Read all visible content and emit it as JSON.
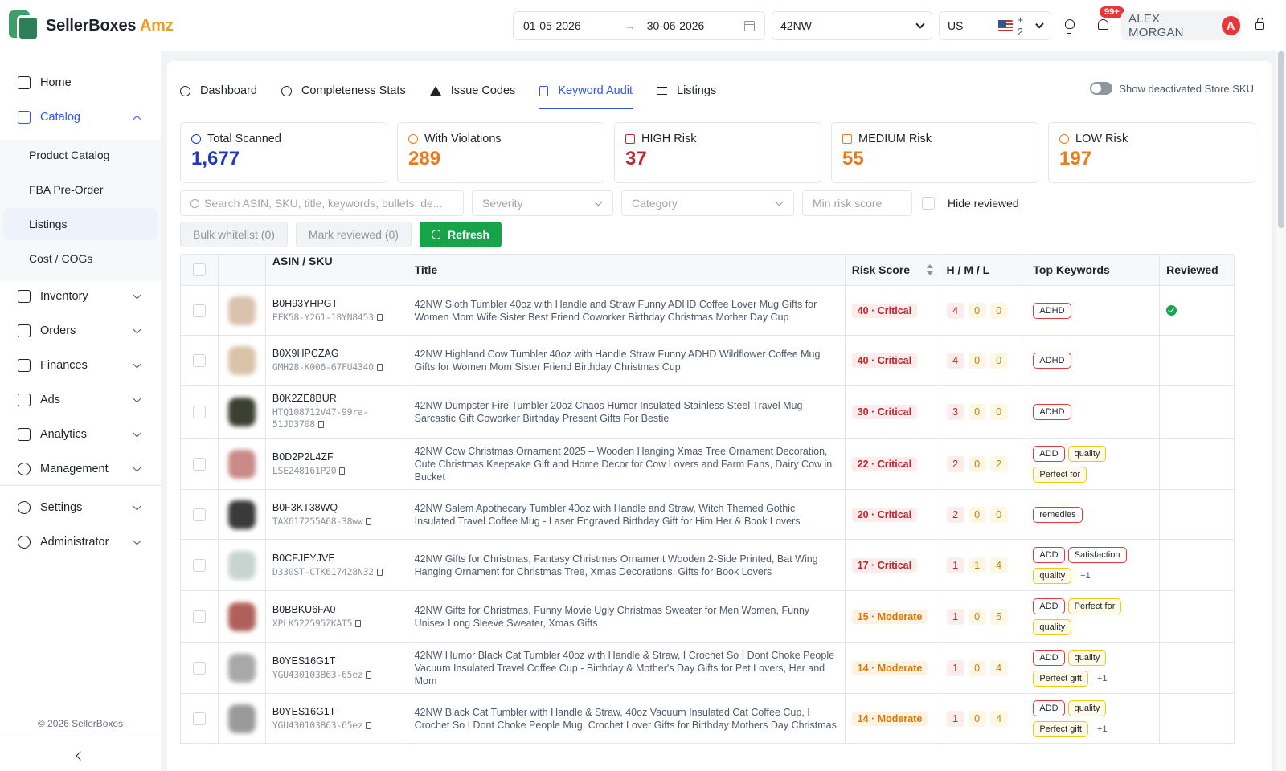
{
  "app": {
    "name": "SellerBoxes",
    "name_suffix": "Amz"
  },
  "topbar": {
    "date_from": "01-05-2026",
    "date_arrow": "→",
    "date_to": "30-06-2026",
    "store": "42NW",
    "marketplace": "US",
    "marketplace_extra": "+ 2",
    "notifications_badge": "99+",
    "user_name": "ALEX MORGAN",
    "user_initial": "A"
  },
  "sidebar": {
    "items": [
      {
        "label": "Home"
      },
      {
        "label": "Catalog"
      },
      {
        "label": "Inventory"
      },
      {
        "label": "Orders"
      },
      {
        "label": "Finances"
      },
      {
        "label": "Ads"
      },
      {
        "label": "Analytics"
      },
      {
        "label": "Management"
      },
      {
        "label": "Settings"
      },
      {
        "label": "Administrator"
      }
    ],
    "catalog_sub": [
      {
        "label": "Product Catalog"
      },
      {
        "label": "FBA Pre-Order"
      },
      {
        "label": "Listings"
      },
      {
        "label": "Cost / COGs"
      }
    ],
    "copyright": "© 2026 SellerBoxes"
  },
  "tabs": [
    {
      "label": "Dashboard"
    },
    {
      "label": "Completeness Stats"
    },
    {
      "label": "Issue Codes"
    },
    {
      "label": "Keyword Audit"
    },
    {
      "label": "Listings"
    }
  ],
  "toggle_label": "Show deactivated Store SKU",
  "stats": [
    {
      "label": "Total Scanned",
      "value": "1,677",
      "color": "#1d39c4"
    },
    {
      "label": "With Violations",
      "value": "289",
      "color": "#ea7a1a"
    },
    {
      "label": "HIGH Risk",
      "value": "37",
      "color": "#c0262d"
    },
    {
      "label": "MEDIUM Risk",
      "value": "55",
      "color": "#ea7a1a"
    },
    {
      "label": "LOW Risk",
      "value": "197",
      "color": "#ea7a1a"
    }
  ],
  "filters": {
    "search_placeholder": "Search ASIN, SKU, title, keywords, bullets, de...",
    "severity_placeholder": "Severity",
    "category_placeholder": "Category",
    "min_risk_placeholder": "Min risk score",
    "hide_reviewed": "Hide reviewed"
  },
  "actions": {
    "bulk_whitelist": "Bulk whitelist (0)",
    "mark_reviewed": "Mark reviewed (0)",
    "refresh": "Refresh"
  },
  "table": {
    "headers": [
      "ASIN / SKU",
      "Title",
      "Risk Score",
      "H / M / L",
      "Top Keywords",
      "Reviewed"
    ],
    "rows": [
      {
        "asin": "B0H93YHPGT",
        "sku": "EFK58-Y261-18YN8453",
        "title": "42NW Sloth Tumbler 40oz with Handle and Straw Funny ADHD Coffee Lover Mug Gifts for Women Mom Wife Sister Best Friend Coworker Birthday Christmas Mother Day Cup",
        "risk": "40 · Critical",
        "h": "4",
        "m": "0",
        "l": "0",
        "reviewed": true,
        "thumb": "#d8c2ae"
      },
      {
        "asin": "B0X9HPCZAG",
        "sku": "GMH28-K006-67FU4340",
        "title": "42NW Highland Cow Tumbler 40oz with Handle Straw Funny ADHD Wildflower Coffee Mug Gifts for Women Mom Sister Friend Birthday Christmas Cup",
        "risk": "40 · Critical",
        "h": "4",
        "m": "0",
        "l": "0",
        "reviewed": false,
        "thumb": "#d9c3a8"
      },
      {
        "asin": "B0K2ZE8BUR",
        "sku": "HTQ108712V47-99ra-51JD3708",
        "title": "42NW Dumpster Fire Tumbler 20oz Chaos Humor Insulated Stainless Steel Travel Mug Sarcastic Gift Coworker Birthday Present Gifts For Bestie",
        "risk": "30 · Critical",
        "h": "3",
        "m": "0",
        "l": "0",
        "reviewed": false,
        "thumb": "#3c4030"
      },
      {
        "asin": "B0D2P2L4ZF",
        "sku": "LSE248161P20",
        "title": "42NW Cow Christmas Ornament 2025 – Wooden Hanging Xmas Tree Ornament Decoration, Cute Christmas Keepsake Gift and Home Decor for Cow Lovers and Farm Fans, Dairy Cow in Bucket",
        "risk": "22 · Critical",
        "h": "2",
        "m": "0",
        "l": "2",
        "reviewed": false,
        "thumb": "#c98a88"
      },
      {
        "asin": "B0F3KT38WQ",
        "sku": "TAX617255A68-38ww",
        "title": "42NW Salem Apothecary Tumbler 40oz with Handle and Straw, Witch Themed Gothic Insulated Travel Coffee Mug - Laser Engraved Birthday Gift for Him Her & Book Lovers",
        "risk": "20 · Critical",
        "h": "2",
        "m": "0",
        "l": "0",
        "reviewed": false,
        "thumb": "#3a3a3a"
      },
      {
        "asin": "B0CFJEYJVE",
        "sku": "D330ST-CTK617428N32",
        "title": "42NW Gifts for Christmas, Fantasy Christmas Ornament Wooden 2-Side Printed, Bat Wing Hanging Ornament for Christmas Tree, Xmas Decorations, Gifts for Book Lovers",
        "risk": "17 · Critical",
        "h": "1",
        "m": "1",
        "l": "4",
        "reviewed": false,
        "thumb": "#c8d4d0"
      },
      {
        "asin": "B0BBKU6FA0",
        "sku": "XPLK522595ZKAT5",
        "title": "42NW Gifts for Christmas, Funny Movie Ugly Christmas Sweater for Men Women, Funny Unisex Long Sleeve Sweater, Xmas Gifts",
        "risk": "15 · Moderate",
        "h": "1",
        "m": "0",
        "l": "5",
        "reviewed": false,
        "thumb": "#b0605a"
      },
      {
        "asin": "B0YES16G1T",
        "sku": "YGU430103B63-65ez",
        "title": "42NW Humor Black Cat Tumbler 40oz with Handle & Straw, I Crochet So I Dont Choke People Vacuum Insulated Travel Coffee Cup - Birthday & Mother's Day Gifts for Pet Lovers, Her and Mom",
        "risk": "14 · Moderate",
        "h": "1",
        "m": "0",
        "l": "4",
        "reviewed": false,
        "thumb": "#a8a8a8"
      },
      {
        "asin": "B0YES16G1T",
        "sku": "YGU430103B63-65ez",
        "title": "42NW Black Cat Tumbler with Handle & Straw, 40oz Vacuum Insulated Cat Coffee Cup, I Crochet So I Dont Choke People Mug, Crochet Lover Gifts for Birthday Mothers Day Christmas",
        "risk": "14 · Moderate",
        "h": "1",
        "m": "0",
        "l": "4",
        "reviewed": false,
        "thumb": "#9a9a9a"
      }
    ]
  },
  "colors": {
    "accent": "#2f54eb",
    "success": "#16a34a",
    "critical": "#c0262d",
    "moderate": "#d97706"
  },
  "icons": [
    "calendar-icon",
    "bulb-icon",
    "bell-icon",
    "lock-icon",
    "search-icon",
    "refresh-icon",
    "copy-icon",
    "check-circle-icon"
  ]
}
